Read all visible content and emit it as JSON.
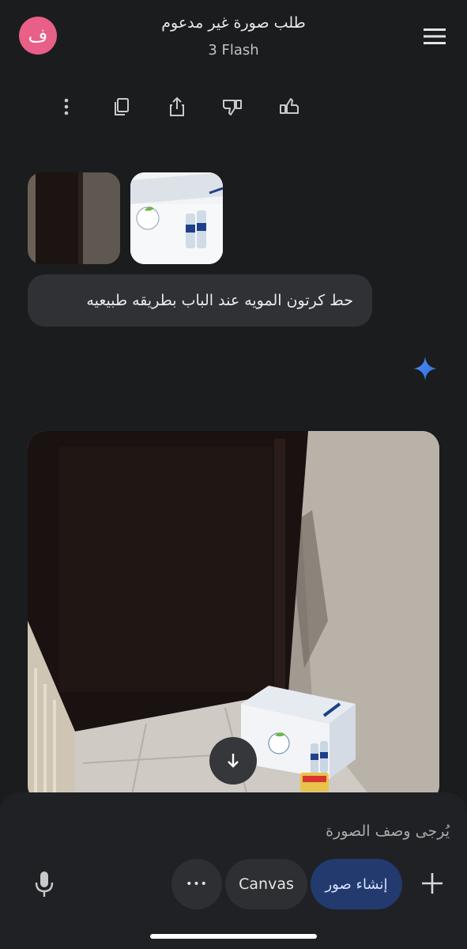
{
  "header": {
    "avatar_letter": "ف",
    "title": "طلب صورة غير مدعوم",
    "subtitle": "3 Flash",
    "menu_icon": "hamburger-menu-icon"
  },
  "actions": {
    "icons": [
      "more-vert-icon",
      "copy-icon",
      "share-icon",
      "thumbs-down-icon",
      "thumbs-up-icon"
    ]
  },
  "thumbnails": [
    {
      "kind": "door-photo"
    },
    {
      "kind": "water-carton-photo",
      "brand_text": "نوفا"
    }
  ],
  "user_message": "حط كرتون المويه عند الباب بطريقه طبيعيه",
  "response": {
    "spark_icon": "gemini-spark-icon",
    "image_carton_brand": "نوفا"
  },
  "composer": {
    "placeholder": "يُرجى وصف الصورة",
    "more_label": "•••",
    "canvas_label": "Canvas",
    "create_image_label": "إنشاء صور",
    "mic_icon": "microphone-icon",
    "plus_icon": "plus-icon"
  },
  "colors": {
    "background": "#1b1c1e",
    "avatar": "#e85f87",
    "accent_pill": "#223a6e",
    "spark": "#4d8ef7"
  }
}
